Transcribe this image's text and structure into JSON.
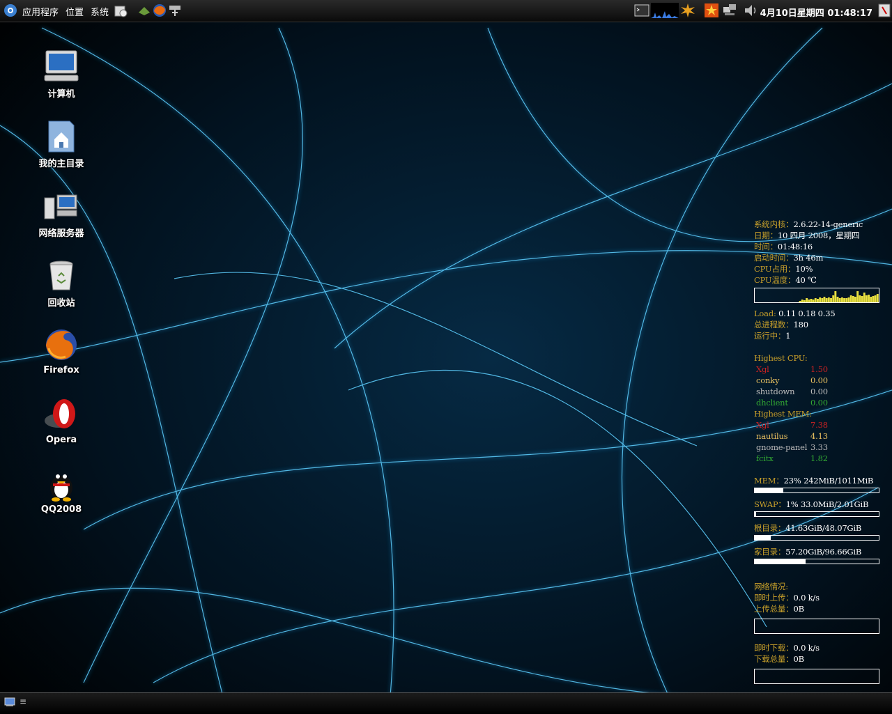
{
  "top_panel": {
    "menus": [
      "应用程序",
      "位置",
      "系统"
    ],
    "clock": "4月10日星期四 01:48:17"
  },
  "desktop_icons": [
    {
      "label": "计算机",
      "icon": "computer-icon"
    },
    {
      "label": "我的主目录",
      "icon": "home-folder-icon"
    },
    {
      "label": "网络服务器",
      "icon": "network-servers-icon"
    },
    {
      "label": "回收站",
      "icon": "trash-icon"
    },
    {
      "label": "Firefox",
      "icon": "firefox-icon"
    },
    {
      "label": "Opera",
      "icon": "opera-icon"
    },
    {
      "label": "QQ2008",
      "icon": "qq-penguin-icon"
    }
  ],
  "conky": {
    "kernel_label": "系统内核：",
    "kernel": "2.6.22-14-generic",
    "date_label": "日期：",
    "date": "10 四月 2008，星期四",
    "time_label": "时间：",
    "time": "01:48:16",
    "uptime_label": "启动时间：",
    "uptime": "3h 46m",
    "cpu_label": "CPU占用：",
    "cpu": "10%",
    "temp_label": "CPU温度：",
    "temp": "40 ℃",
    "load_label": "Load:",
    "load": "0.11 0.18 0.35",
    "procs_label": "总进程数：",
    "procs": "180",
    "running_label": "运行中：",
    "running": "1",
    "highest_cpu_label": "Highest CPU:",
    "highest_cpu": [
      {
        "name": "Xgl",
        "value": "1.50",
        "color": "#cc2222"
      },
      {
        "name": "conky",
        "value": "0.00",
        "color": "#e8c060"
      },
      {
        "name": "shutdown",
        "value": "0.00",
        "color": "#bbbbbb"
      },
      {
        "name": "dhclient",
        "value": "0.00",
        "color": "#33aa33"
      }
    ],
    "highest_mem_label": "Highest MEM:",
    "highest_mem": [
      {
        "name": "Xgl",
        "value": "7.38",
        "color": "#cc2222"
      },
      {
        "name": "nautilus",
        "value": "4.13",
        "color": "#e8c060"
      },
      {
        "name": "gnome-panel",
        "value": "3.33",
        "color": "#bbbbbb"
      },
      {
        "name": "fcitx",
        "value": "1.82",
        "color": "#33aa33"
      }
    ],
    "mem_label": "MEM：",
    "mem": "23% 242MiB/1011MiB",
    "mem_fraction": 0.23,
    "swap_label": "SWAP：",
    "swap": "1% 33.0MiB/2.01GiB",
    "swap_fraction": 0.01,
    "root_label": "根目录：",
    "root": "41.63GiB/48.07GiB",
    "root_fraction": 0.13,
    "home_label": "家目录：",
    "home": "57.20GiB/96.66GiB",
    "home_fraction": 0.41,
    "net_label": "网络情况:",
    "up_rate_label": "即时上传：",
    "up_rate": "0.0  k/s",
    "up_total_label": "上传总量：",
    "up_total": "0B",
    "down_rate_label": "即时下载：",
    "down_rate": "0.0  k/s",
    "down_total_label": "下载总量：",
    "down_total": "0B",
    "graph_values": [
      0,
      0,
      0,
      0,
      0,
      0,
      0,
      0,
      0,
      0,
      0,
      0,
      0,
      0,
      0,
      0,
      0,
      0,
      0,
      0,
      0.1,
      0.2,
      0.15,
      0.3,
      0.2,
      0.25,
      0.2,
      0.3,
      0.25,
      0.35,
      0.3,
      0.4,
      0.3,
      0.35,
      0.3,
      0.5,
      0.8,
      0.4,
      0.3,
      0.35,
      0.3,
      0.3,
      0.35,
      0.5,
      0.45,
      0.4,
      0.8,
      0.5,
      0.45,
      0.7,
      0.5,
      0.55,
      0.4,
      0.45,
      0.5,
      0.6
    ]
  },
  "colors": {
    "conky_label": "#c8a02a",
    "wallpaper_glow": "#2aa6e8"
  }
}
